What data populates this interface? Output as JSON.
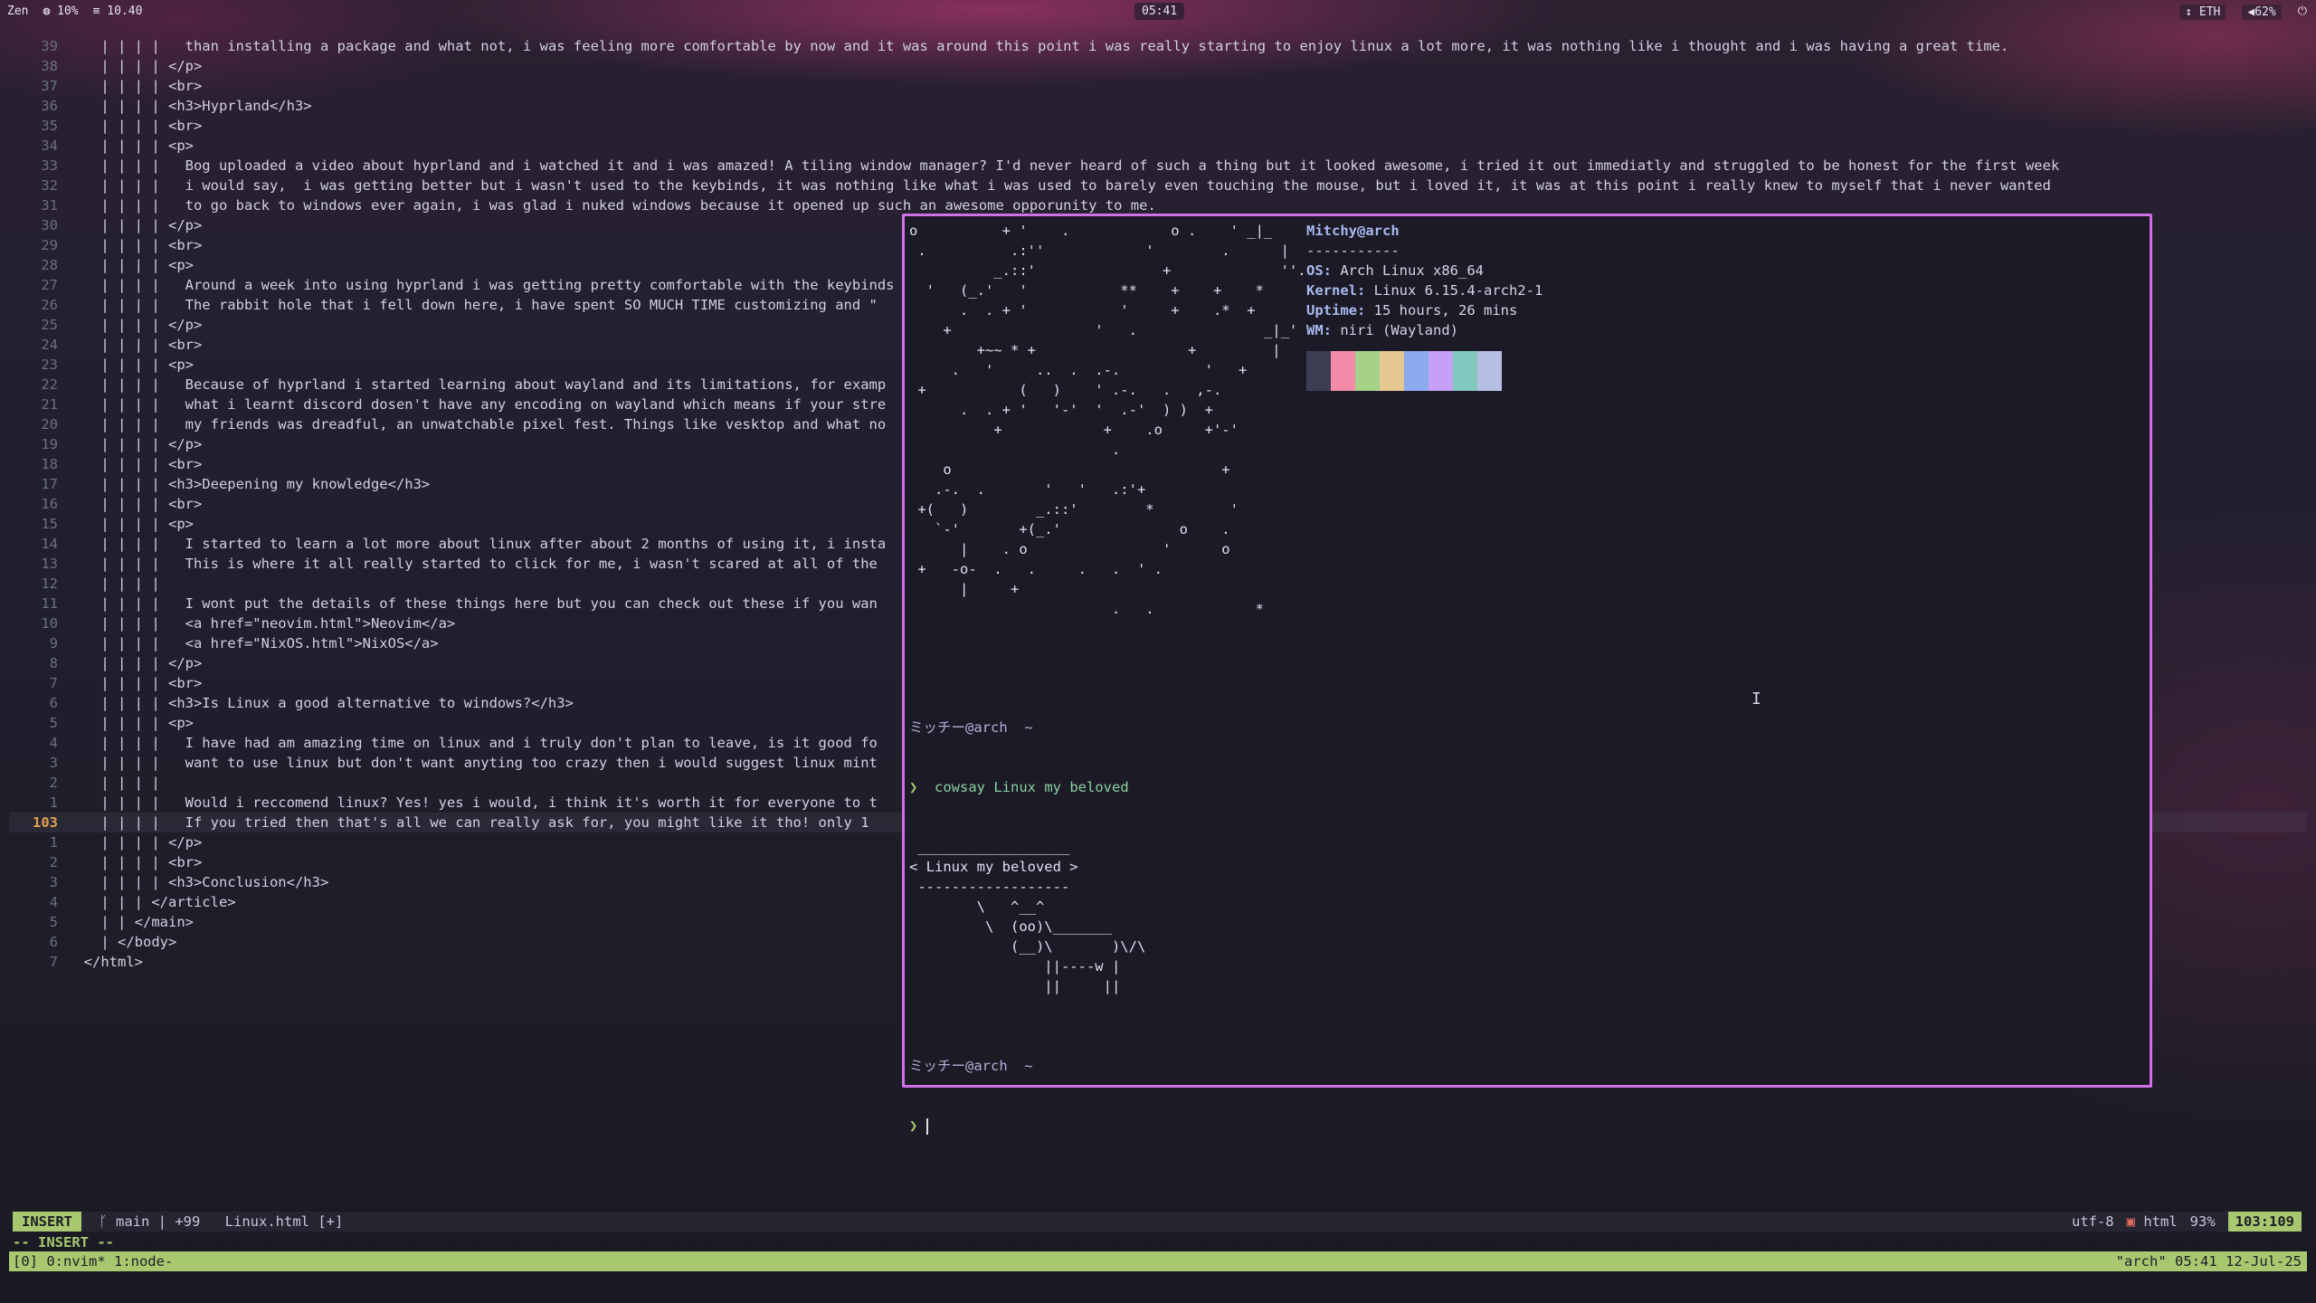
{
  "topbar": {
    "workspace": "Zen",
    "cpu": "10%",
    "mem": "10.40",
    "clock": "05:41",
    "network": "ETH",
    "volume": "62%"
  },
  "editor_lines": [
    {
      "n": "39",
      "t": "    | | | |   than installing a package and what not, i was feeling more comfortable by now and it was around this point i was really starting to enjoy linux a lot more, it was nothing like i thought and i was having a great time."
    },
    {
      "n": "38",
      "t": "    | | | | </p>"
    },
    {
      "n": "37",
      "t": "    | | | | <br>"
    },
    {
      "n": "36",
      "t": "    | | | | <h3>Hyprland</h3>"
    },
    {
      "n": "35",
      "t": "    | | | | <br>"
    },
    {
      "n": "34",
      "t": "    | | | | <p>"
    },
    {
      "n": "33",
      "t": "    | | | |   Bog uploaded a video about hyprland and i watched it and i was amazed! A tiling window manager? I'd never heard of such a thing but it looked awesome, i tried it out immediatly and struggled to be honest for the first week"
    },
    {
      "n": "32",
      "t": "    | | | |   i would say,  i was getting better but i wasn't used to the keybinds, it was nothing like what i was used to barely even touching the mouse, but i loved it, it was at this point i really knew to myself that i never wanted"
    },
    {
      "n": "31",
      "t": "    | | | |   to go back to windows ever again, i was glad i nuked windows because it opened up such an awesome opporunity to me."
    },
    {
      "n": "30",
      "t": "    | | | | </p>"
    },
    {
      "n": "29",
      "t": "    | | | | <br>"
    },
    {
      "n": "28",
      "t": "    | | | | <p>"
    },
    {
      "n": "27",
      "t": "    | | | |   Around a week into using hyprland i was getting pretty comfortable with the keybinds"
    },
    {
      "n": "26",
      "t": "    | | | |   The rabbit hole that i fell down here, i have spent SO MUCH TIME customizing and \""
    },
    {
      "n": "25",
      "t": "    | | | | </p>"
    },
    {
      "n": "24",
      "t": "    | | | | <br>"
    },
    {
      "n": "23",
      "t": "    | | | | <p>"
    },
    {
      "n": "22",
      "t": "    | | | |   Because of hyprland i started learning about wayland and its limitations, for examp"
    },
    {
      "n": "21",
      "t": "    | | | |   what i learnt discord dosen't have any encoding on wayland which means if your stre"
    },
    {
      "n": "20",
      "t": "    | | | |   my friends was dreadful, an unwatchable pixel fest. Things like vesktop and what no"
    },
    {
      "n": "19",
      "t": "    | | | | </p>"
    },
    {
      "n": "18",
      "t": "    | | | | <br>"
    },
    {
      "n": "17",
      "t": "    | | | | <h3>Deepening my knowledge</h3>"
    },
    {
      "n": "16",
      "t": "    | | | | <br>"
    },
    {
      "n": "15",
      "t": "    | | | | <p>"
    },
    {
      "n": "14",
      "t": "    | | | |   I started to learn a lot more about linux after about 2 months of using it, i insta"
    },
    {
      "n": "13",
      "t": "    | | | |   This is where it all really started to click for me, i wasn't scared at all of the"
    },
    {
      "n": "12",
      "t": "    | | | |"
    },
    {
      "n": "11",
      "t": "    | | | |   I wont put the details of these things here but you can check out these if you wan"
    },
    {
      "n": "10",
      "t": "    | | | |   <a href=\"neovim.html\">Neovim</a>"
    },
    {
      "n": "9",
      "t": "    | | | |   <a href=\"NixOS.html\">NixOS</a>"
    },
    {
      "n": "8",
      "t": "    | | | | </p>"
    },
    {
      "n": "7",
      "t": "    | | | | <br>"
    },
    {
      "n": "6",
      "t": "    | | | | <h3>Is Linux a good alternative to windows?</h3>"
    },
    {
      "n": "5",
      "t": "    | | | | <p>"
    },
    {
      "n": "4",
      "t": "    | | | |   I have had am amazing time on linux and i truly don't plan to leave, is it good fo"
    },
    {
      "n": "3",
      "t": "    | | | |   want to use linux but don't want anyting too crazy then i would suggest linux mint"
    },
    {
      "n": "2",
      "t": "    | | | |"
    },
    {
      "n": "1",
      "t": "    | | | |   Would i reccomend linux? Yes! yes i would, i think it's worth it for everyone to t"
    },
    {
      "n": "103",
      "t": "    | | | |   If you tried then that's all we can really ask for, you might like it tho! only 1",
      "cur": true
    },
    {
      "n": "1",
      "t": "    | | | | </p>"
    },
    {
      "n": "2",
      "t": "    | | | | <br>"
    },
    {
      "n": "3",
      "t": "    | | | | <h3>Conclusion</h3>"
    },
    {
      "n": "4",
      "t": "    | | | </article>"
    },
    {
      "n": "5",
      "t": "    | | </main>"
    },
    {
      "n": "6",
      "t": "    | </body>"
    },
    {
      "n": "7",
      "t": "  </html>"
    }
  ],
  "fastfetch": {
    "user": "Mitchy@arch",
    "separator": "-----------",
    "os_key": "OS:",
    "os": "Arch Linux x86_64",
    "kernel_key": "Kernel:",
    "kernel": "Linux 6.15.4-arch2-1",
    "uptime_key": "Uptime:",
    "uptime": "15 hours, 26 mins",
    "wm_key": "WM:",
    "wm": "niri (Wayland)",
    "palette": [
      "#3b3d52",
      "#f38ba8",
      "#a6d189",
      "#e5c890",
      "#8caaee",
      "#c6a0f6",
      "#81c8be",
      "#b5bfe2"
    ]
  },
  "shell": {
    "prompt1": "ミッチー@arch  ~",
    "arrow": "❯",
    "command": "cowsay Linux my beloved",
    "cowsay_top": " __________________",
    "cowsay_msg": "< Linux my beloved >",
    "cowsay_bottom": " ------------------",
    "cow": "        \\   ^__^\n         \\  (oo)\\_______\n            (__)\\       )\\/\\\n                ||----w |\n                ||     ||",
    "prompt2": "ミッチー@arch  ~"
  },
  "status": {
    "mode": "INSERT",
    "branch": "main",
    "changes": "+99",
    "file": "Linux.html [+]",
    "encoding": "utf-8",
    "filetype": "html",
    "percent": "93%",
    "position": "103:109",
    "mode_msg": "-- INSERT --"
  },
  "tmux": {
    "windows": "[0] 0:nvim* 1:node-",
    "right": "\"arch\" 05:41 12-Jul-25"
  }
}
